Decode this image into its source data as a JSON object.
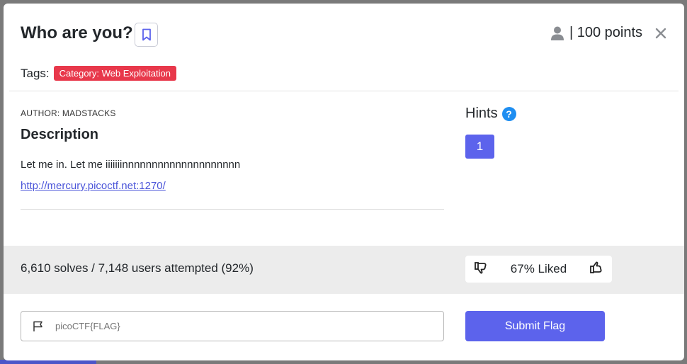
{
  "challenge": {
    "title": "Who are you?",
    "points_label": "| 100 points",
    "tags_label": "Tags:",
    "tags": [
      "Category: Web Exploitation"
    ],
    "author": "AUTHOR: MADSTACKS",
    "description_heading": "Description",
    "description_text": "Let me in. Let me iiiiiiinnnnnnnnnnnnnnnnnnnn",
    "link_text": "http://mercury.picoctf.net:1270/"
  },
  "hints": {
    "heading": "Hints",
    "help_glyph": "?",
    "buttons": [
      "1"
    ]
  },
  "stats": {
    "solves_text": "6,610 solves / 7,148 users attempted (92%)",
    "liked_text": "67% Liked"
  },
  "flag_form": {
    "placeholder": "picoCTF{FLAG}",
    "submit_label": "Submit Flag"
  },
  "icons": {
    "close": "close-icon",
    "bookmark": "bookmark-icon",
    "user": "user-icon",
    "help": "help-icon",
    "thumbs_down": "thumbs-down-icon",
    "thumbs_up": "thumbs-up-icon",
    "flag": "flag-icon"
  },
  "colors": {
    "accent": "#5c63ec",
    "tag_red": "#e8384b",
    "link": "#4b55d9",
    "help_blue": "#1f8ef1"
  }
}
